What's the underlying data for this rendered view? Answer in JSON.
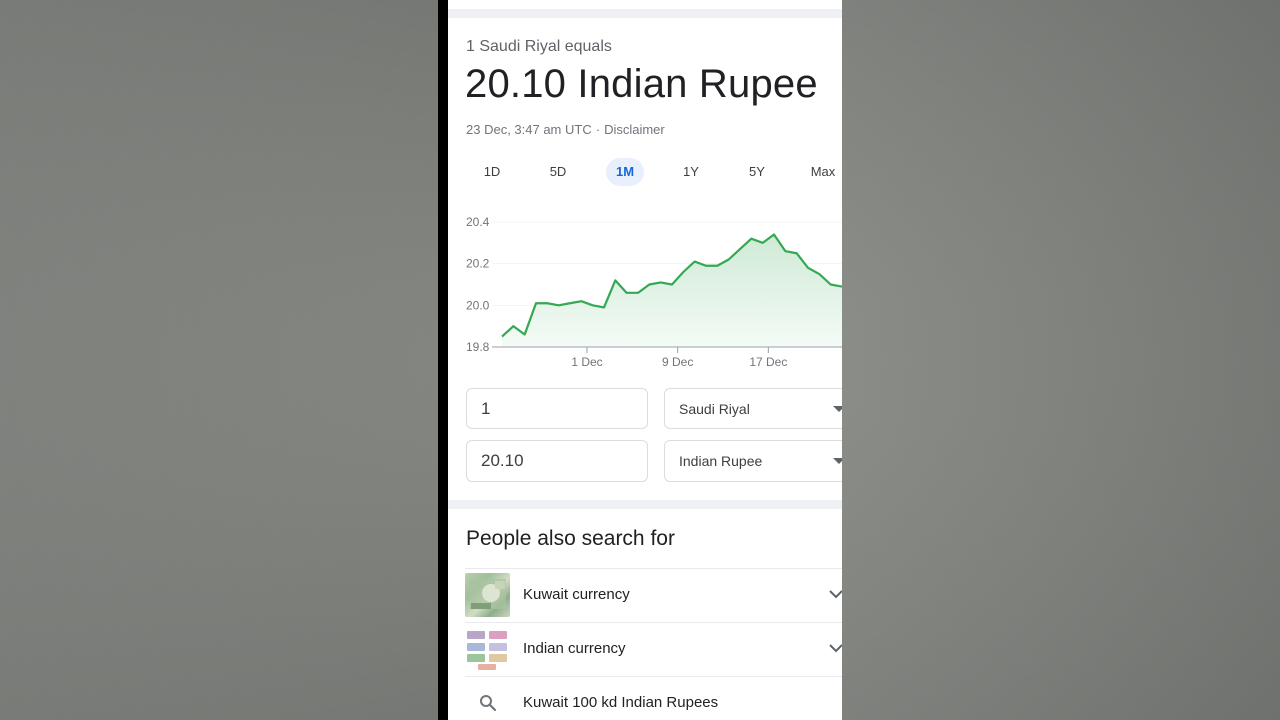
{
  "converter": {
    "subtitle": "1 Saudi Riyal equals",
    "result": "20.10 Indian Rupee",
    "timestamp": "23 Dec, 3:47 am UTC",
    "separator": "·",
    "disclaimer": "Disclaimer",
    "tabs": [
      {
        "label": "1D",
        "active": false
      },
      {
        "label": "5D",
        "active": false
      },
      {
        "label": "1M",
        "active": true
      },
      {
        "label": "1Y",
        "active": false
      },
      {
        "label": "5Y",
        "active": false
      },
      {
        "label": "Max",
        "active": false
      }
    ],
    "amount_from": "1",
    "currency_from": "Saudi Riyal",
    "amount_to": "20.10",
    "currency_to": "Indian Rupee"
  },
  "chart_data": {
    "type": "area",
    "y_ticks": [
      "20.4",
      "20.2",
      "20.0",
      "19.8"
    ],
    "x_ticks": [
      "1 Dec",
      "9 Dec",
      "17 Dec"
    ],
    "ylim": [
      19.8,
      20.4
    ],
    "x": [
      0,
      1,
      2,
      3,
      4,
      5,
      6,
      7,
      8,
      9,
      10,
      11,
      12,
      13,
      14,
      15,
      16,
      17,
      18,
      19,
      20,
      21,
      22,
      23,
      24,
      25,
      26,
      27,
      28,
      29,
      30
    ],
    "values": [
      19.85,
      19.9,
      19.86,
      20.01,
      20.01,
      20.0,
      20.01,
      20.02,
      20.0,
      19.99,
      20.12,
      20.06,
      20.06,
      20.1,
      20.11,
      20.1,
      20.16,
      20.21,
      20.19,
      20.19,
      20.22,
      20.27,
      20.32,
      20.3,
      20.34,
      20.26,
      20.25,
      20.18,
      20.15,
      20.1,
      20.09
    ],
    "color": "#34a853",
    "fill": "#e6f4ea"
  },
  "pasf": {
    "title": "People also search for",
    "items": [
      {
        "label": "Kuwait currency"
      },
      {
        "label": "Indian currency"
      },
      {
        "label": "Kuwait 100 kd Indian Rupees"
      }
    ]
  },
  "icons": {
    "chevron": "chevron-down-icon",
    "search": "search-icon",
    "dropdown": "caret-down-icon"
  }
}
